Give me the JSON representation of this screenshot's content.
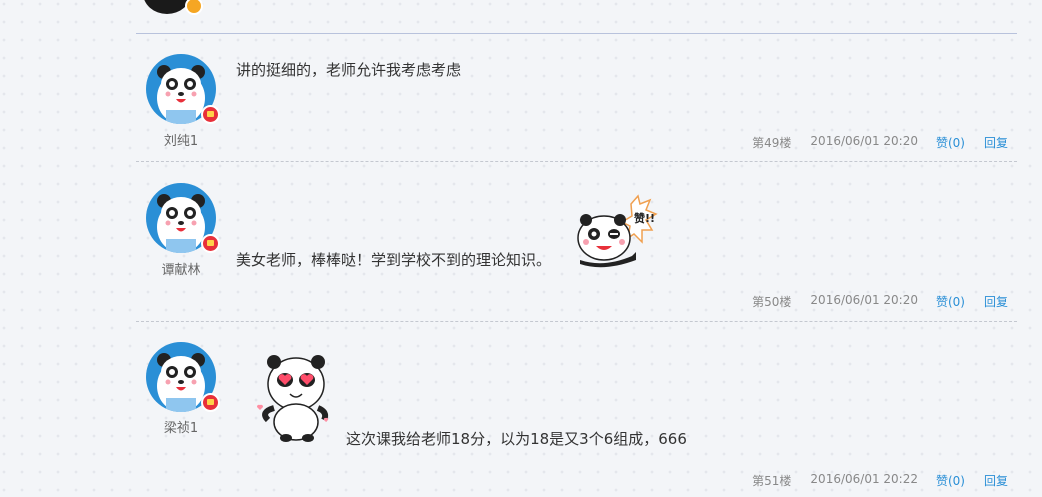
{
  "comments": [
    {
      "username": "刘纯1",
      "text": "讲的挺细的，老师允许我考虑考虑",
      "floor": "第49楼",
      "time": "2016/06/01 20:20",
      "like": "赞(0)",
      "reply": "回复"
    },
    {
      "username": "谭献林",
      "text": "美女老师，棒棒哒！学到学校不到的理论知识。",
      "sticker_text": "赞!!",
      "floor": "第50楼",
      "time": "2016/06/01 20:20",
      "like": "赞(0)",
      "reply": "回复"
    },
    {
      "username": "梁祯1",
      "text": "这次课我给老师18分，以为18是又3个6组成，666",
      "floor": "第51楼",
      "time": "2016/06/01 20:22",
      "like": "赞(0)",
      "reply": "回复"
    }
  ],
  "colors": {
    "accent": "#2a8fd6",
    "avatar_bg": "#2a8fd6",
    "badge": "#e8303a"
  }
}
